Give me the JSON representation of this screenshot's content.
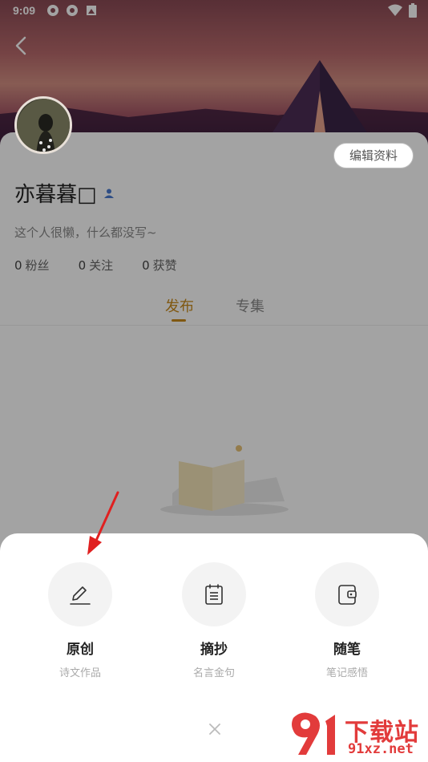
{
  "status": {
    "time": "9:09"
  },
  "profile": {
    "username": "亦暮暮□",
    "bio": "这个人很懒，什么都没写~",
    "edit_label": "编辑资料",
    "stats": [
      {
        "num": "0",
        "label": "粉丝"
      },
      {
        "num": "0",
        "label": "关注"
      },
      {
        "num": "0",
        "label": "获赞"
      }
    ]
  },
  "tabs": [
    {
      "label": "发布",
      "active": true
    },
    {
      "label": "专集",
      "active": false
    }
  ],
  "sheet": {
    "options": [
      {
        "title": "原创",
        "subtitle": "诗文作品",
        "icon": "pencil-icon"
      },
      {
        "title": "摘抄",
        "subtitle": "名言金句",
        "icon": "clipboard-icon"
      },
      {
        "title": "随笔",
        "subtitle": "笔记感悟",
        "icon": "notebook-icon"
      }
    ]
  },
  "watermark": {
    "brand": "下载站",
    "site": "91xz.net"
  },
  "colors": {
    "accent": "#c98a1c",
    "annotation": "#e02020"
  }
}
